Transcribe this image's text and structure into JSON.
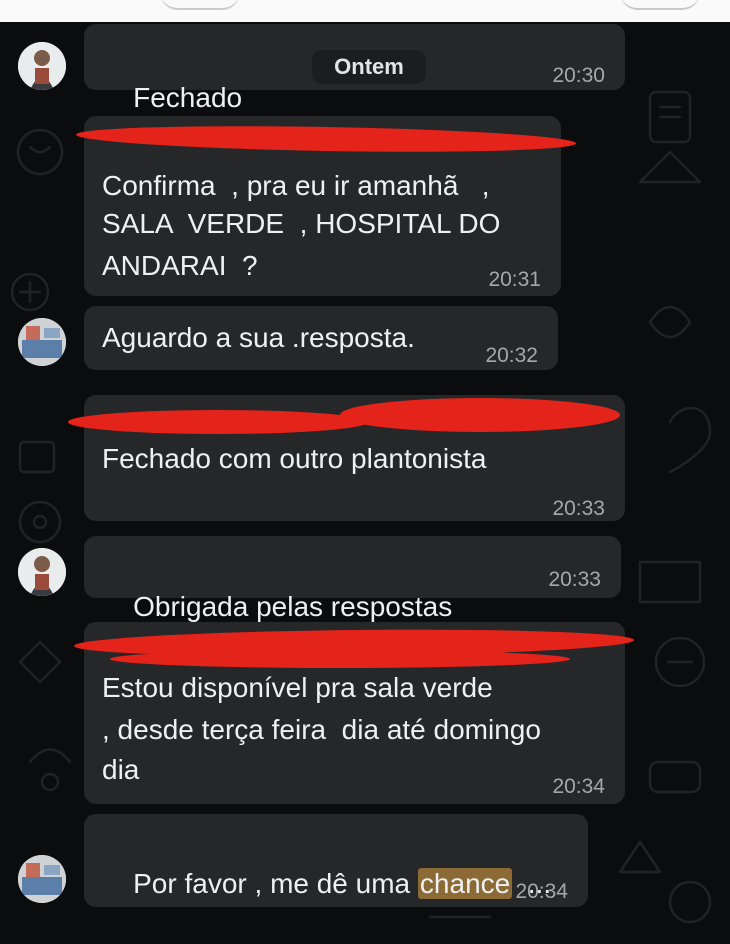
{
  "date_chip": "Ontem",
  "messages": [
    {
      "text": "Fechado",
      "time": "20:30"
    },
    {
      "lines": [
        "Confirma  , pra eu ir amanhã   ,",
        "SALA  VERDE  , HOSPITAL DO",
        "ANDARAI  ?"
      ],
      "time": "20:31"
    },
    {
      "text": "Aguardo a sua .resposta.",
      "time": "20:32"
    },
    {
      "text": "Fechado com outro plantonista",
      "time": "20:33"
    },
    {
      "text": "Obrigada pelas respostas",
      "time": "20:33"
    },
    {
      "lines": [
        "Estou disponível pra sala verde",
        ", desde terça feira  dia até domingo",
        "dia"
      ],
      "time": "20:34"
    },
    {
      "before": "Por favor , me dê uma ",
      "highlight": "chance",
      "after": "  ...",
      "time": "20:34"
    }
  ],
  "icons": {
    "lock": "lock-icon",
    "pray": "folded-hands-icon"
  },
  "colors": {
    "bubble": "#262729",
    "background": "#0b0c0e",
    "redaction": "#e4231a",
    "highlight": "#8b6a36"
  }
}
